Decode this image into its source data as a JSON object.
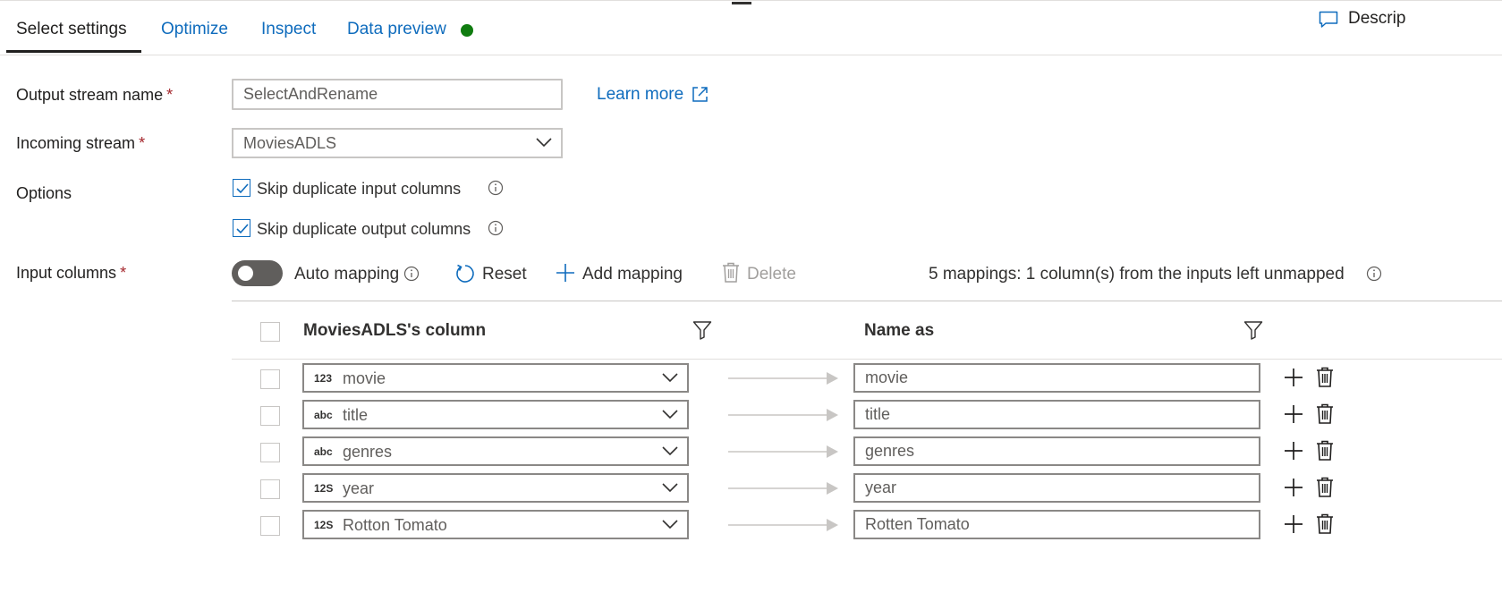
{
  "tabs": [
    {
      "label": "Select settings",
      "active": true
    },
    {
      "label": "Optimize",
      "active": false
    },
    {
      "label": "Inspect",
      "active": false
    },
    {
      "label": "Data preview",
      "active": false
    }
  ],
  "data_preview_status_color": "#107c10",
  "description_button": {
    "label": "Descrip",
    "icon": "comment-icon"
  },
  "form": {
    "output_stream": {
      "label": "Output stream name",
      "required_mark": "*",
      "value": "SelectAndRename"
    },
    "learn_more": {
      "label": "Learn more",
      "icon": "external-link-icon"
    },
    "incoming_stream": {
      "label": "Incoming stream",
      "required_mark": "*",
      "value": "MoviesADLS"
    },
    "options": {
      "label": "Options",
      "items": [
        {
          "label": "Skip duplicate input columns",
          "checked": true
        },
        {
          "label": "Skip duplicate output columns",
          "checked": true
        }
      ]
    },
    "input_columns": {
      "label": "Input columns",
      "required_mark": "*"
    }
  },
  "toolbar": {
    "auto_mapping": {
      "label": "Auto mapping",
      "on": false
    },
    "reset": {
      "label": "Reset"
    },
    "add_mapping": {
      "label": "Add mapping"
    },
    "delete": {
      "label": "Delete",
      "disabled": true
    },
    "summary": "5 mappings: 1 column(s) from the inputs left unmapped"
  },
  "grid": {
    "source_header": "MoviesADLS's column",
    "target_header": "Name as",
    "rows": [
      {
        "type": "123",
        "source": "movie",
        "target": "movie"
      },
      {
        "type": "abc",
        "source": "title",
        "target": "title"
      },
      {
        "type": "abc",
        "source": "genres",
        "target": "genres"
      },
      {
        "type": "12S",
        "source": "year",
        "target": "year"
      },
      {
        "type": "12S",
        "source": "Rotton Tomato",
        "target": "Rotten Tomato"
      }
    ]
  },
  "colors": {
    "accent": "#0f6cbd",
    "required": "#a4262c",
    "toggle_off": "#605e5c"
  }
}
